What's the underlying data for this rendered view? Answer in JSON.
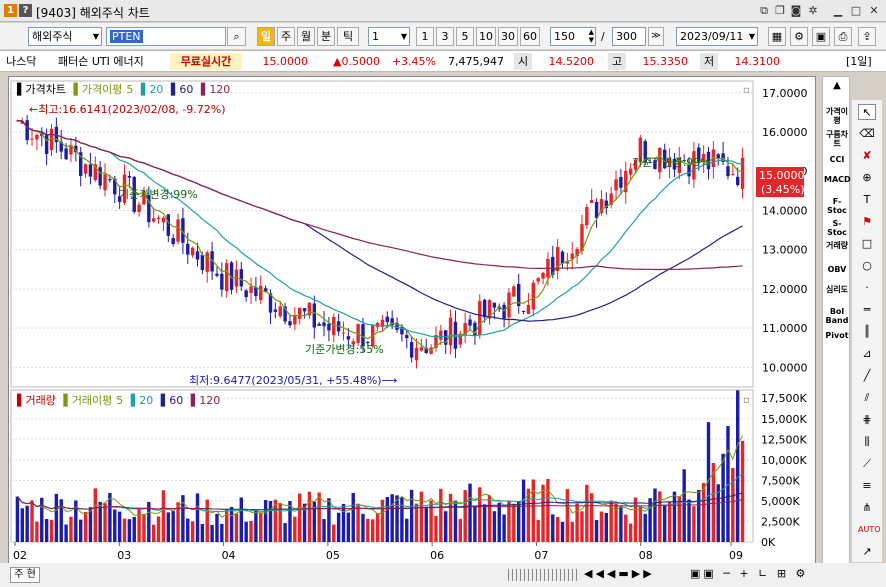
{
  "window": {
    "title": "[9403] 해외주식 차트",
    "badge1": "1",
    "badge2": "?"
  },
  "toolbar": {
    "market": "해외주식",
    "symbol": "PTEN",
    "periods": [
      "일",
      "주",
      "월",
      "분",
      "틱"
    ],
    "interval": "1",
    "quick": [
      "1",
      "3",
      "5",
      "10",
      "30",
      "60"
    ],
    "count": "150",
    "count_sep": "/",
    "total": "300",
    "date": "2023/09/11"
  },
  "quote": {
    "exchange": "나스닥",
    "name": "패터슨 UTI 에너지",
    "live": "무료실시간",
    "price": "15.0000",
    "change": "▲0.5000",
    "rate": "+3.45%",
    "volume": "7,475,947",
    "open_label": "시",
    "open": "14.5200",
    "high_label": "고",
    "high": "15.3350",
    "low_label": "저",
    "low": "14.3100",
    "period_tag": "[1일]"
  },
  "price_panel": {
    "legend": {
      "title": "가격차트",
      "ma_label": "가격이평",
      "ma": [
        "5",
        "20",
        "60",
        "120"
      ]
    },
    "y_ticks": [
      "17.0000",
      "16.0000",
      "15.0000",
      "14.0000",
      "13.0000",
      "12.0000",
      "11.0000",
      "10.0000"
    ],
    "annot_high": "←최고:16.6141(2023/02/08, -9.72%)",
    "annot_low": "최저:9.6477(2023/05/31, +55.48%)⟶",
    "annot_ref": "기준가변경:99%",
    "annot_ref2": "기준가변경:55%",
    "annot_ref3": "기준가변경:99%",
    "last_price": "15.0000",
    "last_rate": "(3.45%)"
  },
  "volume_panel": {
    "legend": {
      "title": "거래량",
      "ma_label": "거래이평",
      "ma": [
        "5",
        "20",
        "60",
        "120"
      ]
    },
    "y_ticks": [
      "17,500K",
      "15,000K",
      "12,500K",
      "10,000K",
      "7,500K",
      "5,000K",
      "2,500K",
      "0K"
    ]
  },
  "x_axis": [
    "02",
    "03",
    "04",
    "05",
    "06",
    "07",
    "08",
    "09"
  ],
  "right_indicators": [
    "가격이평",
    "구름차트",
    "CCI",
    "MACD",
    "F-Stoc",
    "S-Stoc",
    "거래량",
    "OBV",
    "심리도",
    "Bol Band",
    "Pivot"
  ],
  "bottom": {
    "label": "주 현"
  },
  "colors": {
    "up": "#e3262a",
    "down": "#1c1ca8",
    "ma5": "#7a9a0c",
    "ma20": "#20a0a0",
    "ma60": "#222288",
    "ma120": "#8b2252"
  },
  "chart_data": [
    {
      "type": "line",
      "title": "가격차트",
      "x": [
        "02",
        "03",
        "04",
        "05",
        "06",
        "07",
        "08",
        "09"
      ],
      "series": [
        {
          "name": "price",
          "values": [
            16.3,
            14.6,
            12.3,
            11.0,
            10.6,
            12.0,
            15.6,
            15.0
          ]
        }
      ],
      "ylim": [
        9.5,
        17.3
      ]
    },
    {
      "type": "bar",
      "title": "거래량",
      "categories": [
        "02",
        "03",
        "04",
        "05",
        "06",
        "07",
        "08",
        "09"
      ],
      "series": [
        {
          "name": "volume",
          "values": [
            4000,
            4500,
            3500,
            4000,
            4500,
            5000,
            4000,
            12000
          ]
        }
      ],
      "ylim": [
        0,
        18500
      ]
    }
  ]
}
